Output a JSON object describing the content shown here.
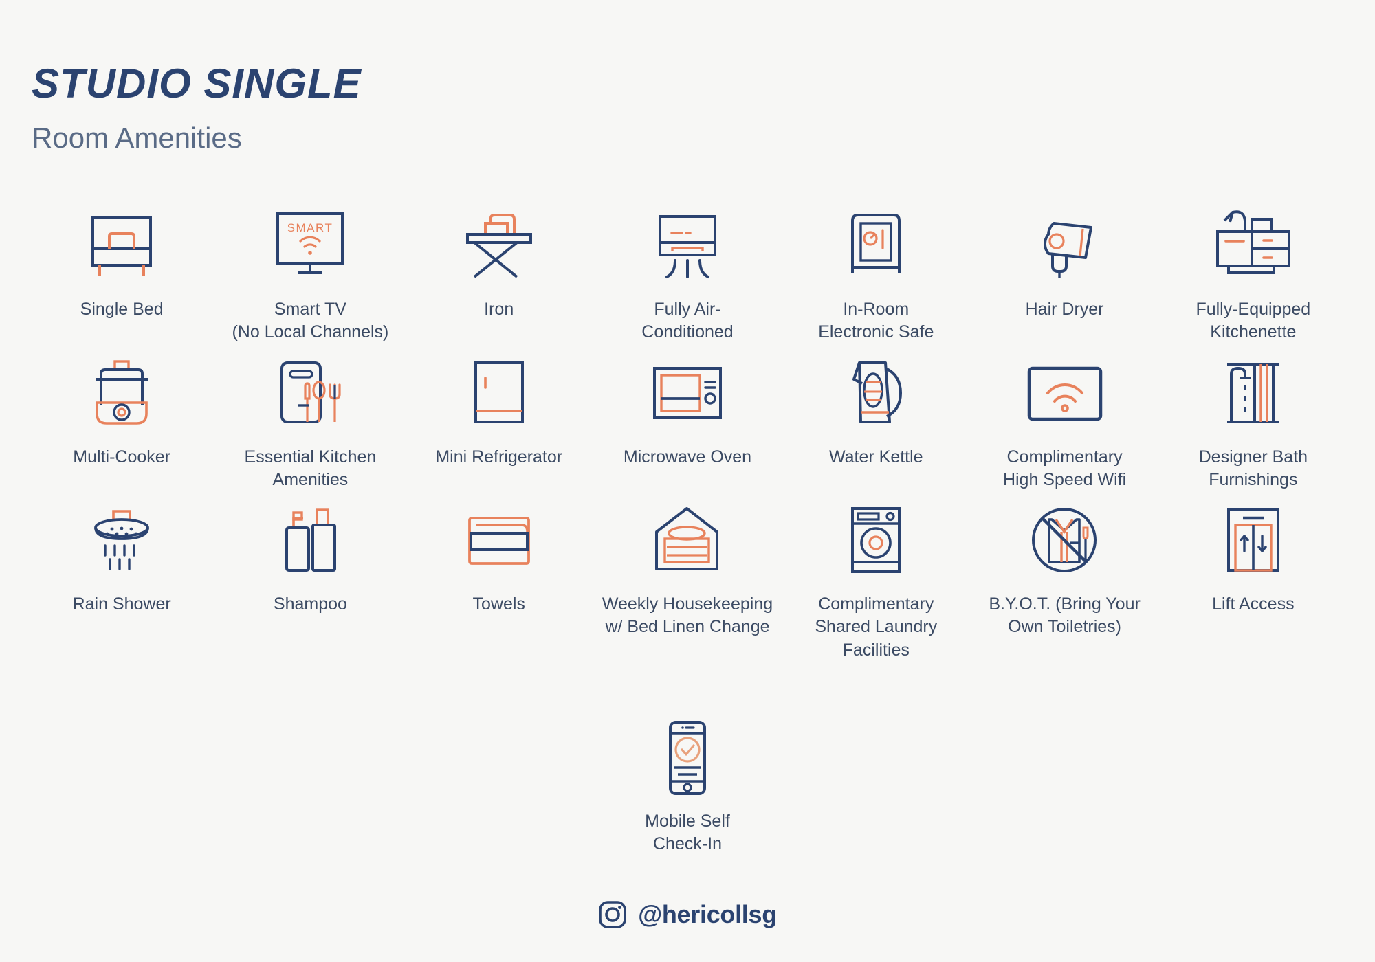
{
  "header": {
    "title": "STUDIO SINGLE",
    "subtitle": "Room Amenities"
  },
  "colors": {
    "background": "#f7f7f5",
    "navy": "#2b4370",
    "navy_text": "#3b4a63",
    "orange": "#e8825c",
    "orange_light": "#f0a882",
    "subtitle": "#5a6b86"
  },
  "amenities": [
    {
      "label": "Single Bed",
      "icon": "bed-icon"
    },
    {
      "label": "Smart TV\n(No Local Channels)",
      "icon": "smart-tv-icon",
      "screen_text": "SMART"
    },
    {
      "label": "Iron",
      "icon": "iron-icon"
    },
    {
      "label": "Fully Air-\nConditioned",
      "icon": "air-conditioner-icon"
    },
    {
      "label": "In-Room\nElectronic Safe",
      "icon": "safe-icon"
    },
    {
      "label": "Hair Dryer",
      "icon": "hair-dryer-icon"
    },
    {
      "label": "Fully-Equipped\nKitchenette",
      "icon": "kitchenette-icon"
    },
    {
      "label": "Multi-Cooker",
      "icon": "multi-cooker-icon"
    },
    {
      "label": "Essential Kitchen\nAmenities",
      "icon": "kitchen-utensils-icon"
    },
    {
      "label": "Mini Refrigerator",
      "icon": "refrigerator-icon"
    },
    {
      "label": "Microwave Oven",
      "icon": "microwave-icon"
    },
    {
      "label": "Water Kettle",
      "icon": "kettle-icon"
    },
    {
      "label": "Complimentary\nHigh Speed Wifi",
      "icon": "wifi-icon"
    },
    {
      "label": "Designer Bath\nFurnishings",
      "icon": "bath-furnishings-icon"
    },
    {
      "label": "Rain Shower",
      "icon": "rain-shower-icon"
    },
    {
      "label": "Shampoo",
      "icon": "shampoo-icon"
    },
    {
      "label": "Towels",
      "icon": "towels-icon"
    },
    {
      "label": "Weekly Housekeeping\nw/ Bed Linen Change",
      "icon": "housekeeping-icon"
    },
    {
      "label": "Complimentary\nShared Laundry\nFacilities",
      "icon": "laundry-icon"
    },
    {
      "label": "B.Y.O.T. (Bring Your\nOwn Toiletries)",
      "icon": "no-toiletries-icon"
    },
    {
      "label": "Lift Access",
      "icon": "lift-icon"
    },
    {
      "label": "Mobile Self\nCheck-In",
      "icon": "mobile-checkin-icon"
    }
  ],
  "footer": {
    "handle": "@hericollsg",
    "icon": "instagram-icon"
  }
}
